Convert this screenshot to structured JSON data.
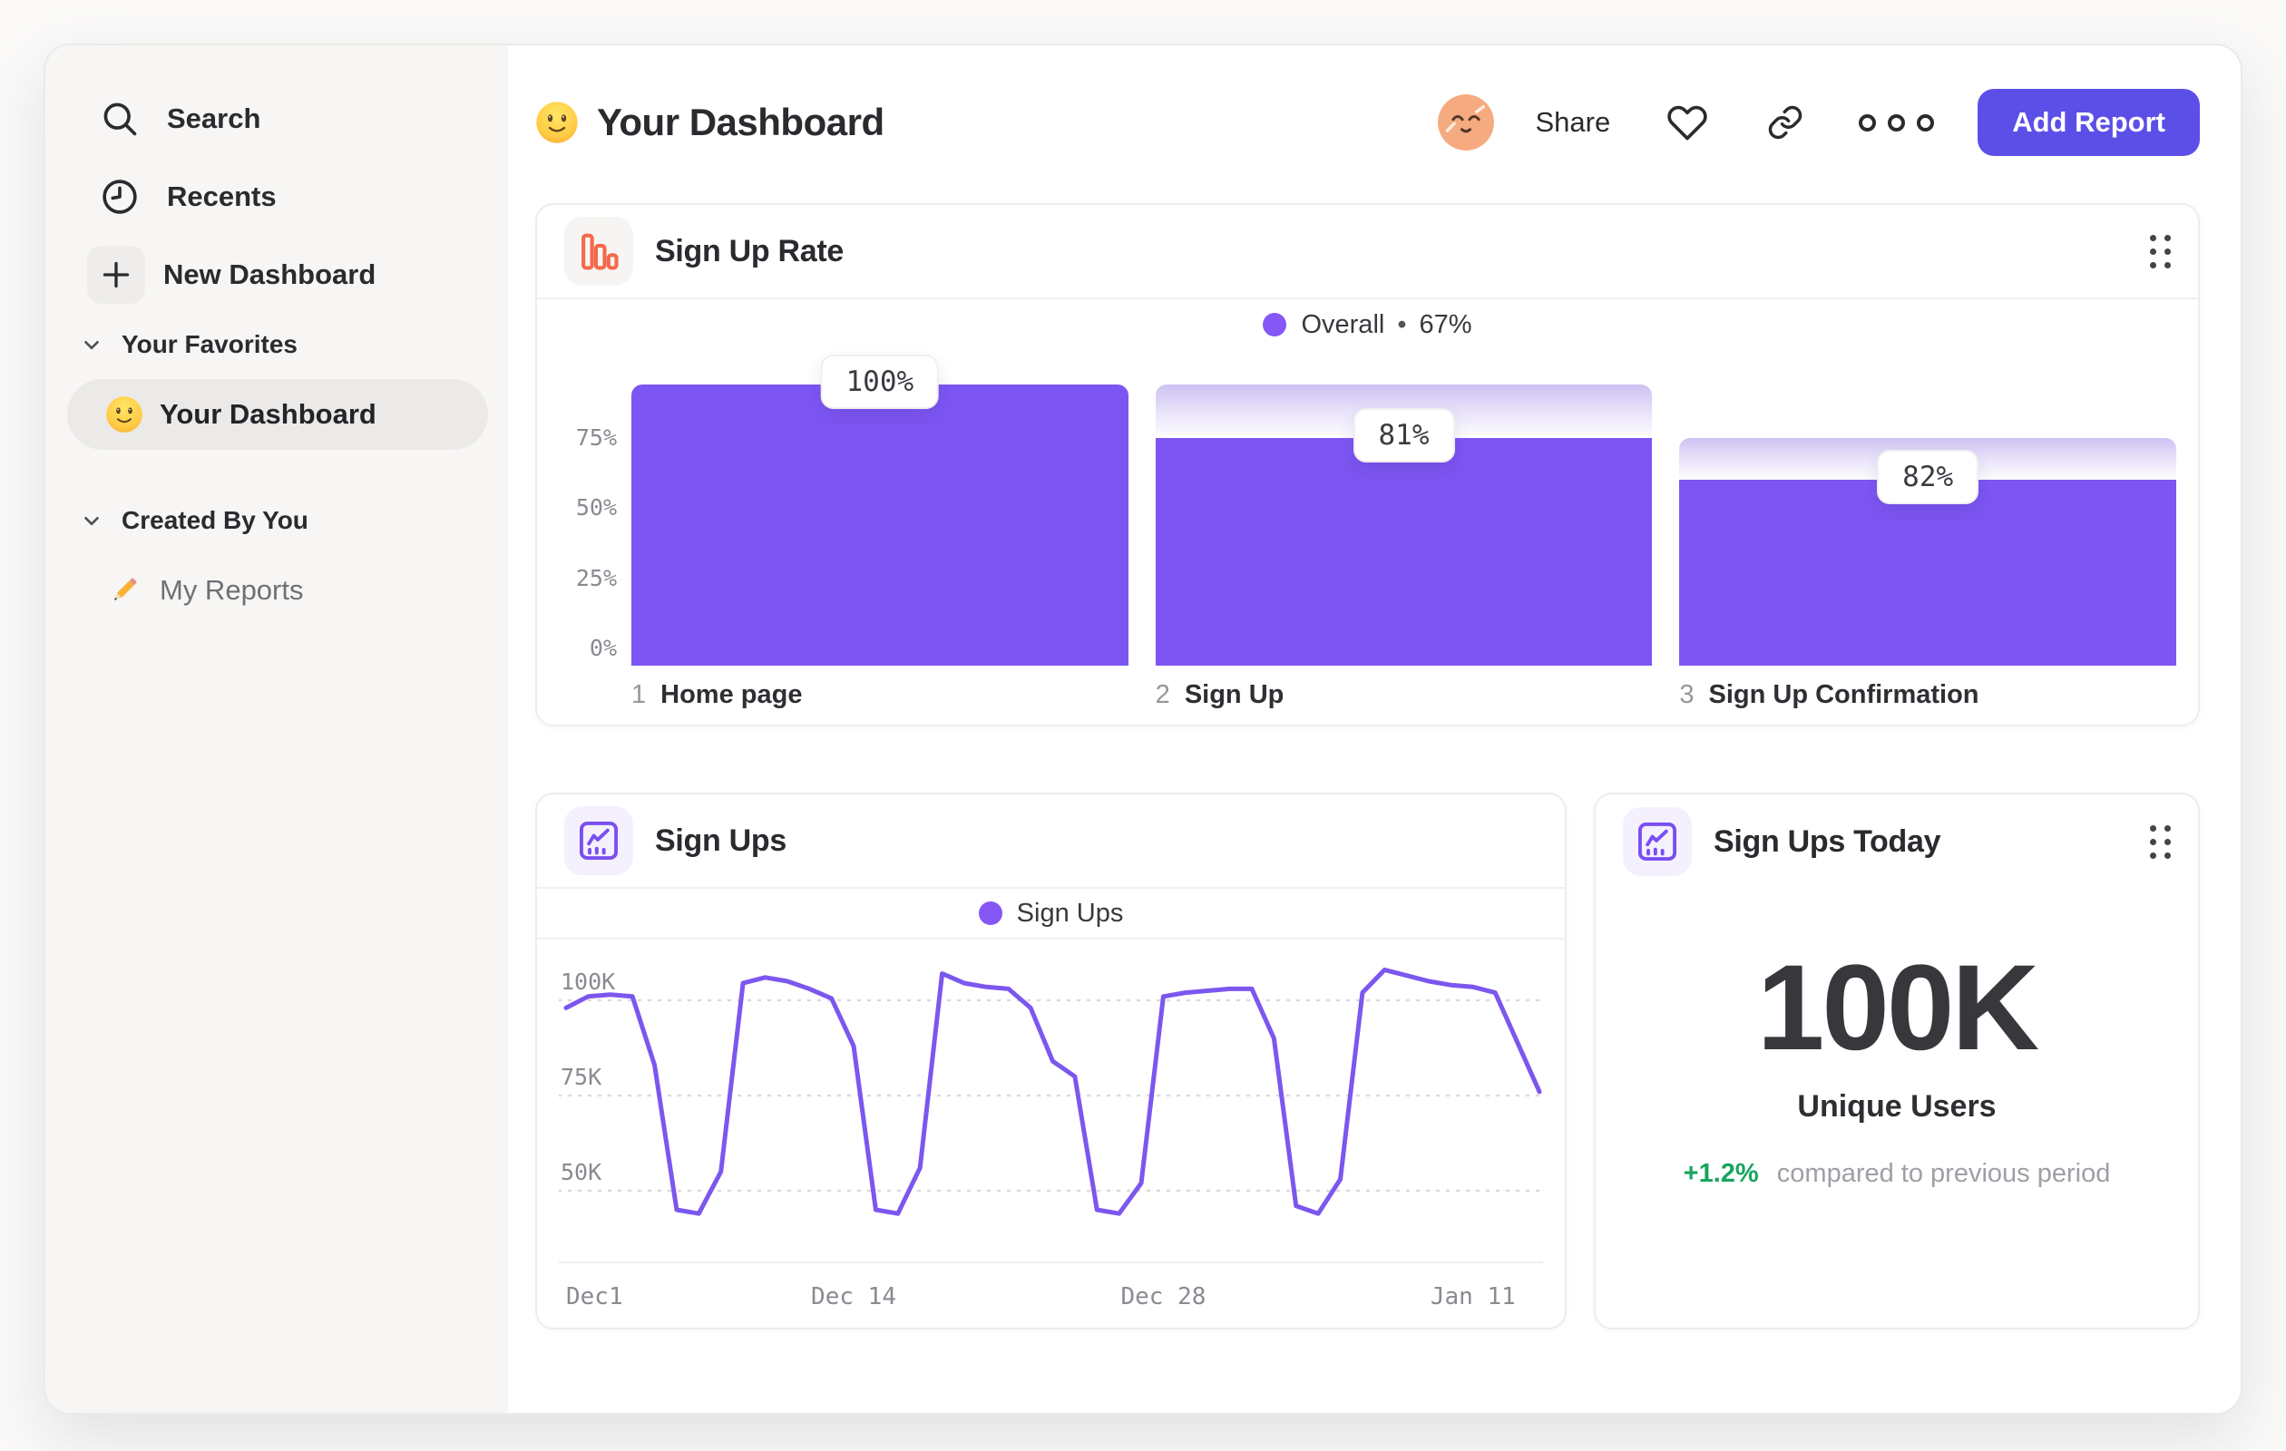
{
  "sidebar": {
    "nav": [
      {
        "id": "search",
        "label": "Search"
      },
      {
        "id": "recents",
        "label": "Recents"
      },
      {
        "id": "new-dashboard",
        "label": "New Dashboard"
      }
    ],
    "sections": [
      {
        "id": "favorites",
        "title": "Your Favorites",
        "items": [
          {
            "id": "your-dashboard",
            "label": "Your Dashboard",
            "icon": "smiley",
            "selected": true
          }
        ]
      },
      {
        "id": "created-by-you",
        "title": "Created By You",
        "items": [
          {
            "id": "my-reports",
            "label": "My Reports",
            "icon": "pencil",
            "selected": false
          }
        ]
      }
    ]
  },
  "header": {
    "title": "Your Dashboard",
    "share_label": "Share",
    "add_report_label": "Add Report"
  },
  "funnel_card": {
    "title": "Sign Up Rate",
    "legend_label": "Overall",
    "legend_separator": "•",
    "legend_value": "67%"
  },
  "line_card": {
    "title": "Sign Ups",
    "legend_label": "Sign Ups"
  },
  "stat_card": {
    "title": "Sign Ups Today",
    "value": "100K",
    "subtitle": "Unique Users",
    "delta": "+1.2%",
    "delta_note": "compared to previous period"
  },
  "colors": {
    "funnel_bar_purple": "#7D55F2",
    "line_purple": "#7B57EE",
    "legend_dot_purple": "#8657F7",
    "add_report_indigo": "#5C4FE8",
    "funnel_icon_coral": "#F4694B",
    "delta_green": "#17A45F",
    "sidebar_bg": "#F7F6F5"
  },
  "chart_data": [
    {
      "type": "bar",
      "variant": "funnel",
      "title": "Sign Up Rate",
      "legend": "Overall • 67%",
      "overall_conversion_pct": 67,
      "categories": [
        "Home page",
        "Sign Up",
        "Sign Up Confirmation"
      ],
      "steps": [
        {
          "index": "1",
          "label": "Home page",
          "badge": "100%",
          "step_conversion_pct": 100,
          "cumulative_pct": 100
        },
        {
          "index": "2",
          "label": "Sign Up",
          "badge": "81%",
          "step_conversion_pct": 81,
          "cumulative_pct": 81
        },
        {
          "index": "3",
          "label": "Sign Up Confirmation",
          "badge": "82%",
          "step_conversion_pct": 82,
          "cumulative_pct": 66
        }
      ],
      "yticks_pct": [
        75,
        50,
        25,
        0
      ],
      "ylim": [
        0,
        100
      ],
      "legend_position": "top-center"
    },
    {
      "type": "line",
      "title": "Sign Ups",
      "legend": "Sign Ups",
      "unit": "K",
      "ylim_k": [
        33,
        115
      ],
      "y_gridlines_k": [
        100,
        75,
        50
      ],
      "y_tick_labels": [
        "100K",
        "75K",
        "50K"
      ],
      "x_tick_labels": [
        {
          "label": "Dec1",
          "index": 0
        },
        {
          "label": "Dec 14",
          "index": 13
        },
        {
          "label": "Dec 28",
          "index": 27
        },
        {
          "label": "Jan 11",
          "index": 41
        }
      ],
      "series": [
        {
          "name": "Sign Ups",
          "values_k": [
            98,
            101,
            101.5,
            101,
            83,
            45,
            44,
            55,
            104.5,
            106,
            105,
            103,
            100.5,
            88,
            45,
            44,
            56,
            107,
            104.5,
            103.5,
            103,
            98,
            84,
            80,
            45,
            44,
            52,
            101,
            102,
            102.5,
            103,
            103,
            90,
            46,
            44,
            53,
            102,
            108,
            106.5,
            105,
            104,
            103.5,
            102,
            89,
            76
          ]
        }
      ],
      "grid": "dashed-horizontal",
      "legend_position": "top-center"
    }
  ]
}
